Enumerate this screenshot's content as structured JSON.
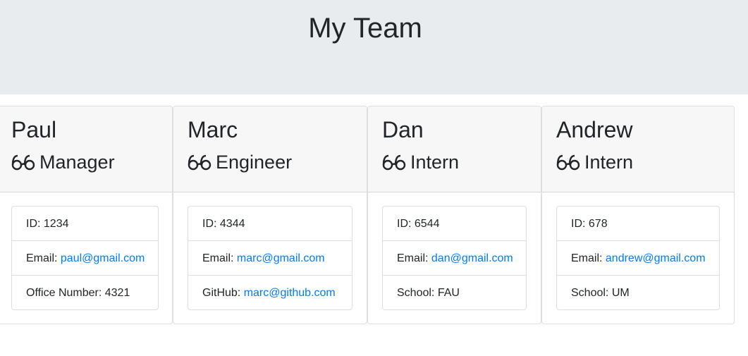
{
  "header": {
    "title": "My Team"
  },
  "cards": [
    {
      "name": "Paul",
      "role": "Manager",
      "role_icon": "glasses-icon",
      "id_label": "ID: 1234",
      "email_prefix": "Email: ",
      "email": "paul@gmail.com",
      "extra_prefix": "Office Number: 4321",
      "extra_link": ""
    },
    {
      "name": "Marc",
      "role": "Engineer",
      "role_icon": "glasses-icon",
      "id_label": "ID: 4344",
      "email_prefix": "Email: ",
      "email": "marc@gmail.com",
      "extra_prefix": "GitHub: ",
      "extra_link": "marc@github.com"
    },
    {
      "name": "Dan",
      "role": "Intern",
      "role_icon": "glasses-icon",
      "id_label": "ID: 6544",
      "email_prefix": "Email: ",
      "email": "dan@gmail.com",
      "extra_prefix": "School: FAU",
      "extra_link": ""
    },
    {
      "name": "Andrew",
      "role": "Intern",
      "role_icon": "glasses-icon",
      "id_label": "ID: 678",
      "email_prefix": "Email: ",
      "email": "andrew@gmail.com",
      "extra_prefix": "School: UM",
      "extra_link": ""
    }
  ],
  "colors": {
    "link": "#007bff",
    "header_bg": "#e9ecef",
    "card_header_bg": "#f7f7f7"
  }
}
